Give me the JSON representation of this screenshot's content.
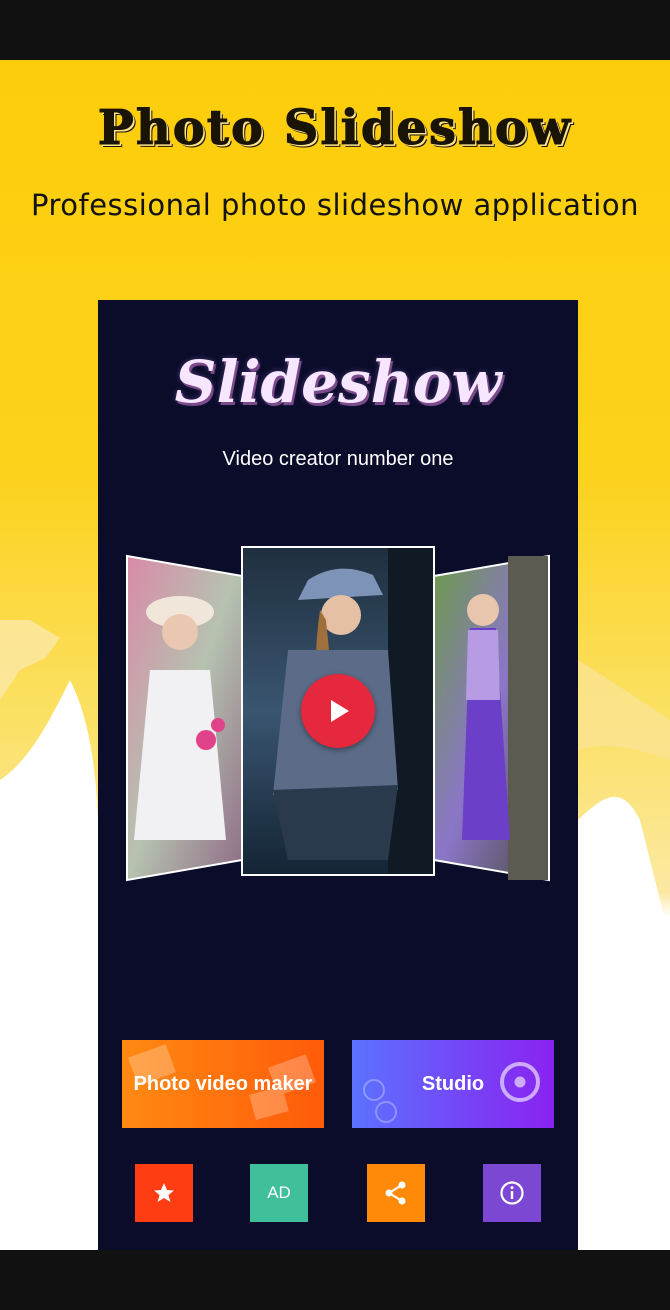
{
  "promo": {
    "title": "Photo Slideshow",
    "subtitle": "Professional photo slideshow application"
  },
  "app": {
    "logo_text": "Slideshow",
    "tagline": "Video creator number one"
  },
  "slides": [
    {
      "name": "slide-left",
      "subject": "girl-in-white-hat"
    },
    {
      "name": "slide-center",
      "subject": "girl-in-blue-cap"
    },
    {
      "name": "slide-right",
      "subject": "girl-in-purple-dress"
    }
  ],
  "buttons": {
    "maker_label": "Photo video maker",
    "studio_label": "Studio"
  },
  "icon_buttons": {
    "rate_icon": "star-icon",
    "ad_label": "AD",
    "share_icon": "share-icon",
    "info_icon": "info-icon"
  },
  "colors": {
    "background": "#fccd0a",
    "panel": "#0a0c2a",
    "play": "#e5283e",
    "maker": "#ff6a10",
    "studio": "#6a4cf8",
    "rate": "#ff3d12",
    "ad": "#3fbf9a",
    "share": "#ff8a0a",
    "info": "#7c47d2"
  }
}
